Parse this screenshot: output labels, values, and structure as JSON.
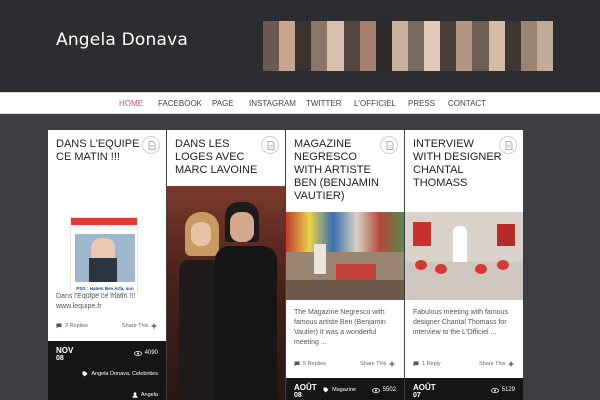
{
  "site": {
    "title": "Angela Donava"
  },
  "nav": {
    "items": [
      "HOME",
      "FACEBOOK",
      "PAGE",
      "INSTAGRAM",
      "TWITTER",
      "L'OFFICIEL",
      "PRESS",
      "CONTACT"
    ],
    "active": "HOME"
  },
  "cards": [
    {
      "title": "DANS L'EQUIPE CE MATIN !!!",
      "thumb_caption": "PSG : Hatem Ben Arfa, son entourage à la loupe",
      "excerpt": "Dans l'Equipe ce matin !!! www.lequipe.fr",
      "replies": "3 Replies",
      "share": "Share This",
      "month": "NOV",
      "day": "08",
      "views": "4090",
      "tags": "Angela Donava, Celebrities",
      "author": "Angela"
    },
    {
      "title": "DANS LES LOGES AVEC MARC LAVOINE"
    },
    {
      "title": "MAGAZINE NEGRESCO WITH ARTISTE BEN (BENJAMIN VAUTIER)",
      "excerpt": "The Magazine Negresco with famous artiste Ben (Benjamin Vautier) It was a wonderful meeting ...",
      "replies": "5 Replies",
      "share": "Share This",
      "month": "AOÛT",
      "day": "08",
      "views": "5502",
      "tags": "Magazine"
    },
    {
      "title": "INTERVIEW WITH DESIGNER CHANTAL THOMASS",
      "excerpt": "Fabulous meeting with famous designer Chantal Thomass for interview to the L'Officiel ...",
      "replies": "1 Reply",
      "share": "Share This",
      "month": "AOÛT",
      "day": "07",
      "views": "5129"
    }
  ],
  "colors": {
    "accent": "#d2586e",
    "background": "#3c3e42",
    "header": "#2b2d31",
    "date_bar": "#161616"
  }
}
